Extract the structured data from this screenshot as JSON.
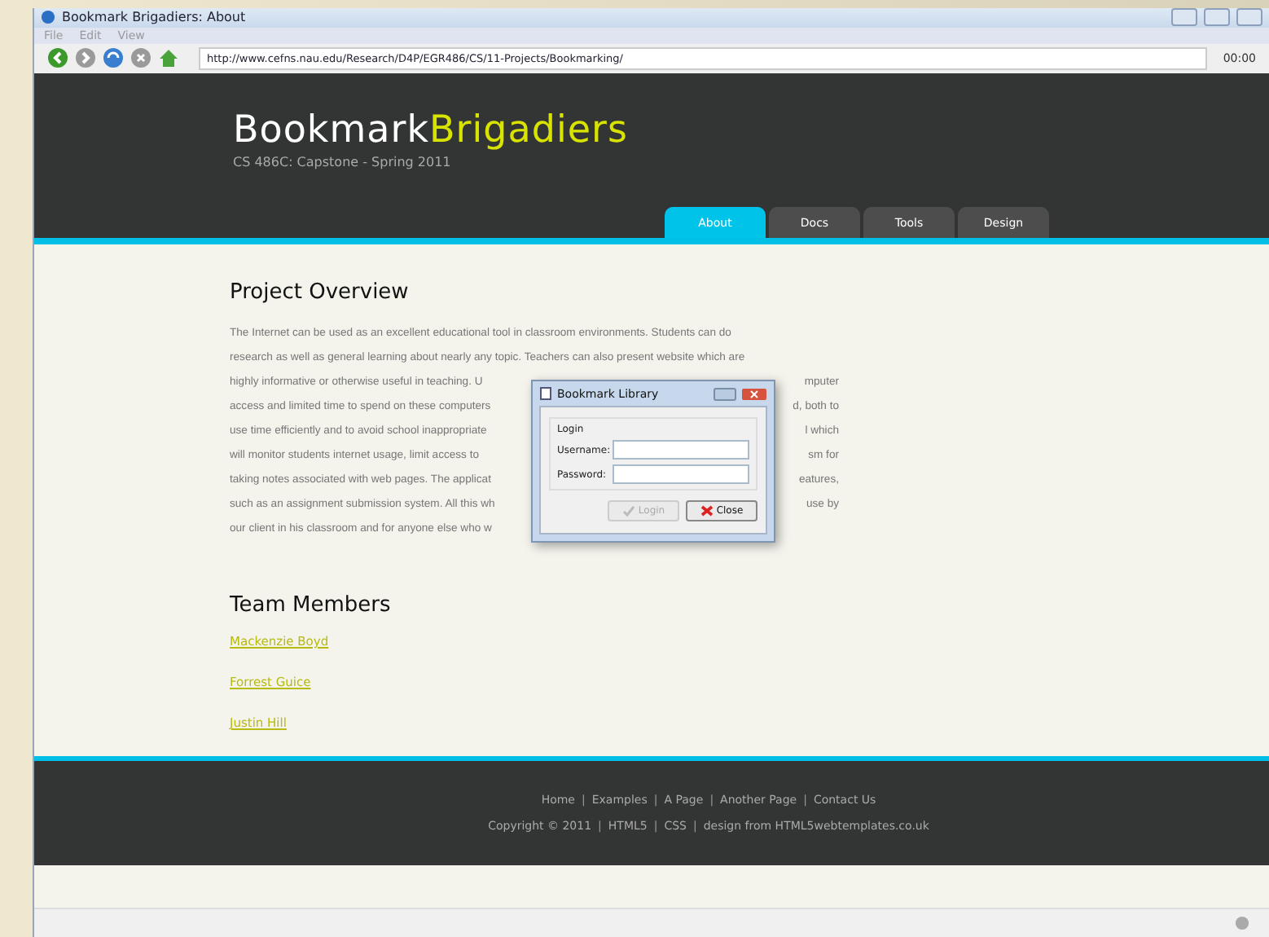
{
  "window": {
    "title": "Bookmark Brigadiers: About",
    "menu": [
      "File",
      "Edit",
      "View"
    ]
  },
  "toolbar": {
    "url": "http://www.cefns.nau.edu/Research/D4P/EGR486/CS/11-Projects/Bookmarking/",
    "time": "00:00"
  },
  "site": {
    "brand": "Bookmark",
    "brand_accent": "Brigadiers",
    "subtitle": "CS 486C: Capstone - Spring 2011",
    "tabs": [
      {
        "label": "About",
        "selected": true
      },
      {
        "label": "Docs",
        "selected": false
      },
      {
        "label": "Tools",
        "selected": false
      },
      {
        "label": "Design",
        "selected": false
      }
    ]
  },
  "overview": {
    "heading": "Project Overview",
    "lines": [
      {
        "left": "The Internet can be used as an excellent educational tool in classroom environments. Students can do"
      },
      {
        "left": "research as well as general learning about nearly any topic. Teachers can also present website which are"
      },
      {
        "left": "highly informative or otherwise useful in teaching. U",
        "right": "mputer"
      },
      {
        "left": "access and limited time to spend on these computers",
        "right": "d, both to"
      },
      {
        "left": "use time efficiently and to avoid school inappropriate",
        "right": "l which"
      },
      {
        "left": "will monitor students internet usage, limit access to",
        "right": "sm for"
      },
      {
        "left": "taking notes associated with web pages. The applicat",
        "right": "eatures,"
      },
      {
        "left": "such as an assignment submission system. All this wh",
        "right": "use by"
      },
      {
        "left": "our client in his classroom and for anyone else who w"
      }
    ]
  },
  "team": {
    "heading": "Team Members",
    "members": [
      "Mackenzie Boyd",
      "Forrest Guice",
      "Justin Hill"
    ]
  },
  "footer": {
    "separator": "|",
    "links": [
      "Home",
      "Examples",
      "A Page",
      "Another Page",
      "Contact Us"
    ],
    "copyright": [
      "Copyright © 2011",
      "HTML5",
      "CSS",
      "design from HTML5webtemplates.co.uk"
    ]
  },
  "dialog": {
    "title": "Bookmark Library",
    "group": "Login",
    "username_label": "Username:",
    "password_label": "Password:",
    "login_button": {
      "label": "Login",
      "disabled": true
    },
    "close_button": "Close"
  }
}
